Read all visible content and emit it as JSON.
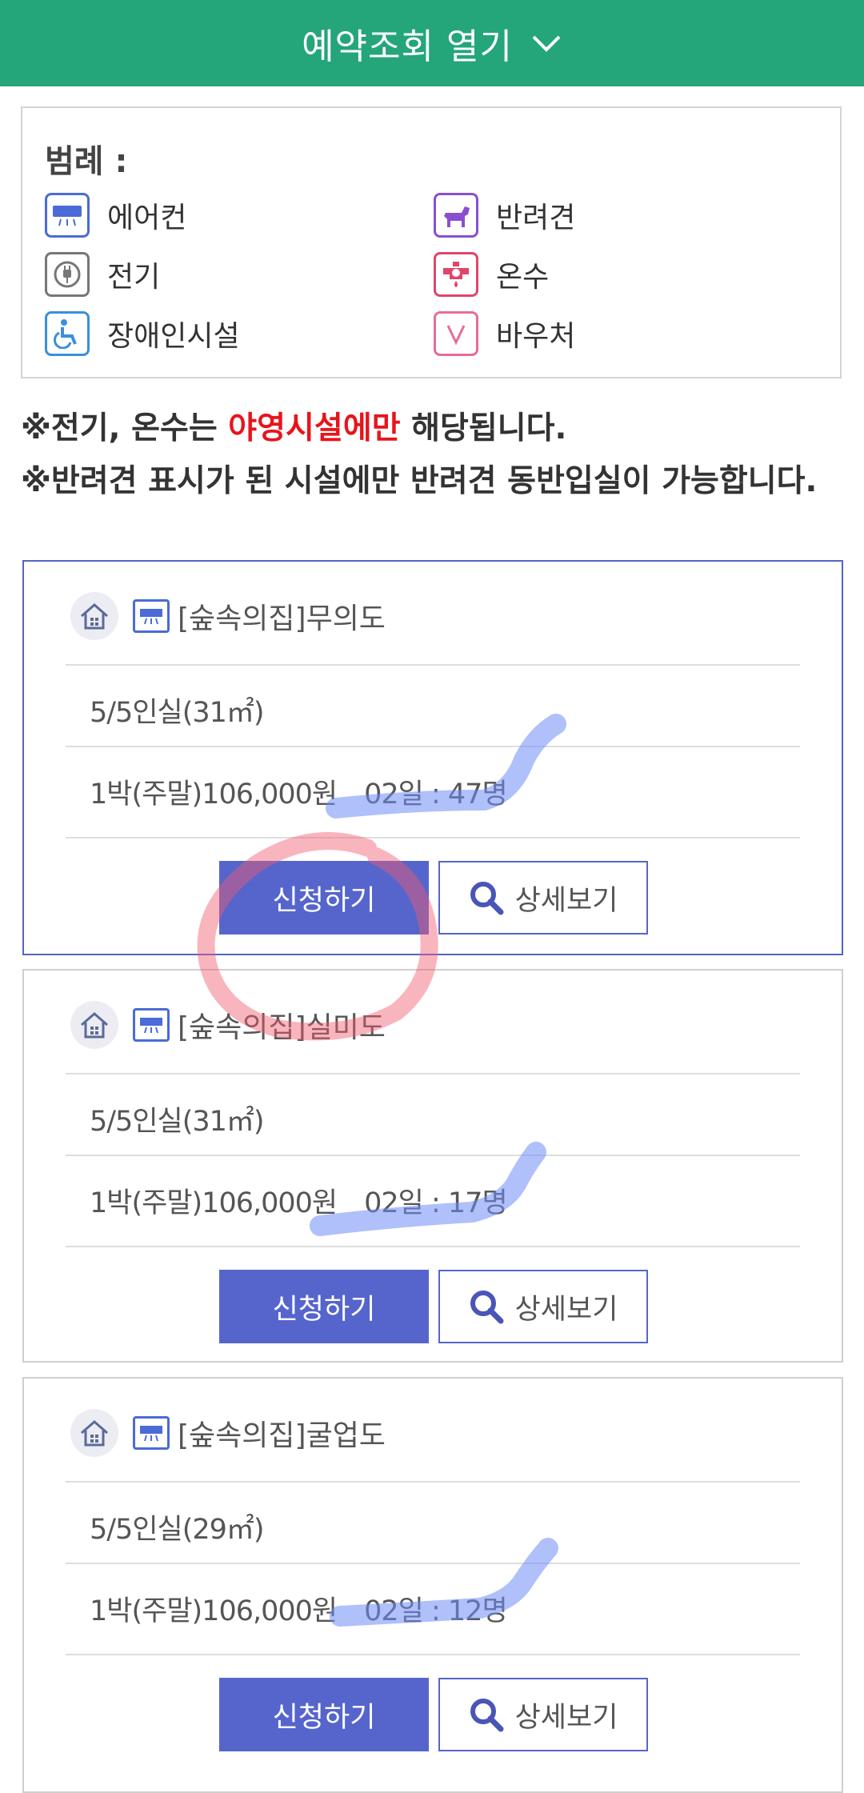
{
  "header": {
    "title": "예약조회 열기"
  },
  "legend": {
    "title": "범례 :",
    "items": [
      {
        "label": "에어컨",
        "icon": "air-conditioner-icon",
        "color": "#4a6bd8"
      },
      {
        "label": "반려견",
        "icon": "dog-icon",
        "color": "#8a4fd0"
      },
      {
        "label": "전기",
        "icon": "electric-plug-icon",
        "color": "#777777"
      },
      {
        "label": "온수",
        "icon": "hot-water-icon",
        "color": "#e0456a"
      },
      {
        "label": "장애인시설",
        "icon": "wheelchair-icon",
        "color": "#3b8fdc"
      },
      {
        "label": "바우처",
        "icon": "voucher-icon",
        "color": "#e86b9a"
      }
    ]
  },
  "notices": {
    "line1_prefix": "※전기, 온수는 ",
    "line1_highlight": "야영시설에만",
    "line1_suffix": " 해당됩니다.",
    "line2": "※반려견 표시가 된 시설에만 반려견 동반입실이 가능합니다."
  },
  "rooms": [
    {
      "name": "[숲속의집]무의도",
      "capacity": "5/5인실(31㎡)",
      "price": "1박(주말)106,000원",
      "waiting": "02일 : 47명",
      "apply_label": "신청하기",
      "detail_label": "상세보기"
    },
    {
      "name": "[숲속의집]실미도",
      "capacity": "5/5인실(31㎡)",
      "price": "1박(주말)106,000원",
      "waiting": "02일 : 17명",
      "apply_label": "신청하기",
      "detail_label": "상세보기"
    },
    {
      "name": "[숲속의집]굴업도",
      "capacity": "5/5인실(29㎡)",
      "price": "1박(주말)106,000원",
      "waiting": "02일 : 12명",
      "apply_label": "신청하기",
      "detail_label": "상세보기"
    }
  ],
  "colors": {
    "header_bg": "#24a57a",
    "accent": "#5665cc",
    "notice_red": "#e8141b"
  }
}
